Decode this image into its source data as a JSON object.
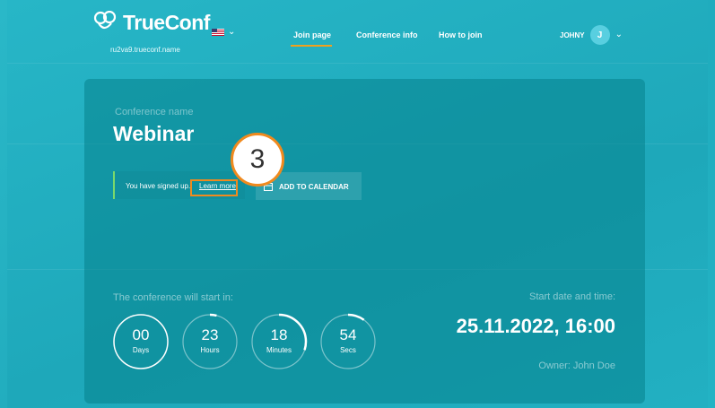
{
  "header": {
    "logo_text": "TrueConf",
    "subdomain": "ru2va9.trueconf.name",
    "nav": [
      {
        "label": "Join page",
        "active": true
      },
      {
        "label": "Conference info",
        "active": false
      },
      {
        "label": "How to join",
        "active": false
      }
    ],
    "user_name": "JOHNY",
    "avatar_initial": "J"
  },
  "conference": {
    "name_label": "Conference name",
    "name": "Webinar",
    "notice_text": "You have signed up.",
    "learn_more": "Learn more",
    "add_to_calendar": "ADD TO CALENDAR",
    "step_number": "3"
  },
  "countdown": {
    "label": "The conference will start in:",
    "items": [
      {
        "value": "00",
        "unit": "Days",
        "progress": 0
      },
      {
        "value": "23",
        "unit": "Hours",
        "progress": 0.04
      },
      {
        "value": "18",
        "unit": "Minutes",
        "progress": 0.3
      },
      {
        "value": "54",
        "unit": "Secs",
        "progress": 0.1
      }
    ]
  },
  "start": {
    "label": "Start date and time:",
    "value": "25.11.2022, 16:00",
    "owner": "Owner: John Doe"
  },
  "colors": {
    "accent": "#f0a11e",
    "highlight": "#f08a1e",
    "notice_bar": "#7ad96b"
  }
}
